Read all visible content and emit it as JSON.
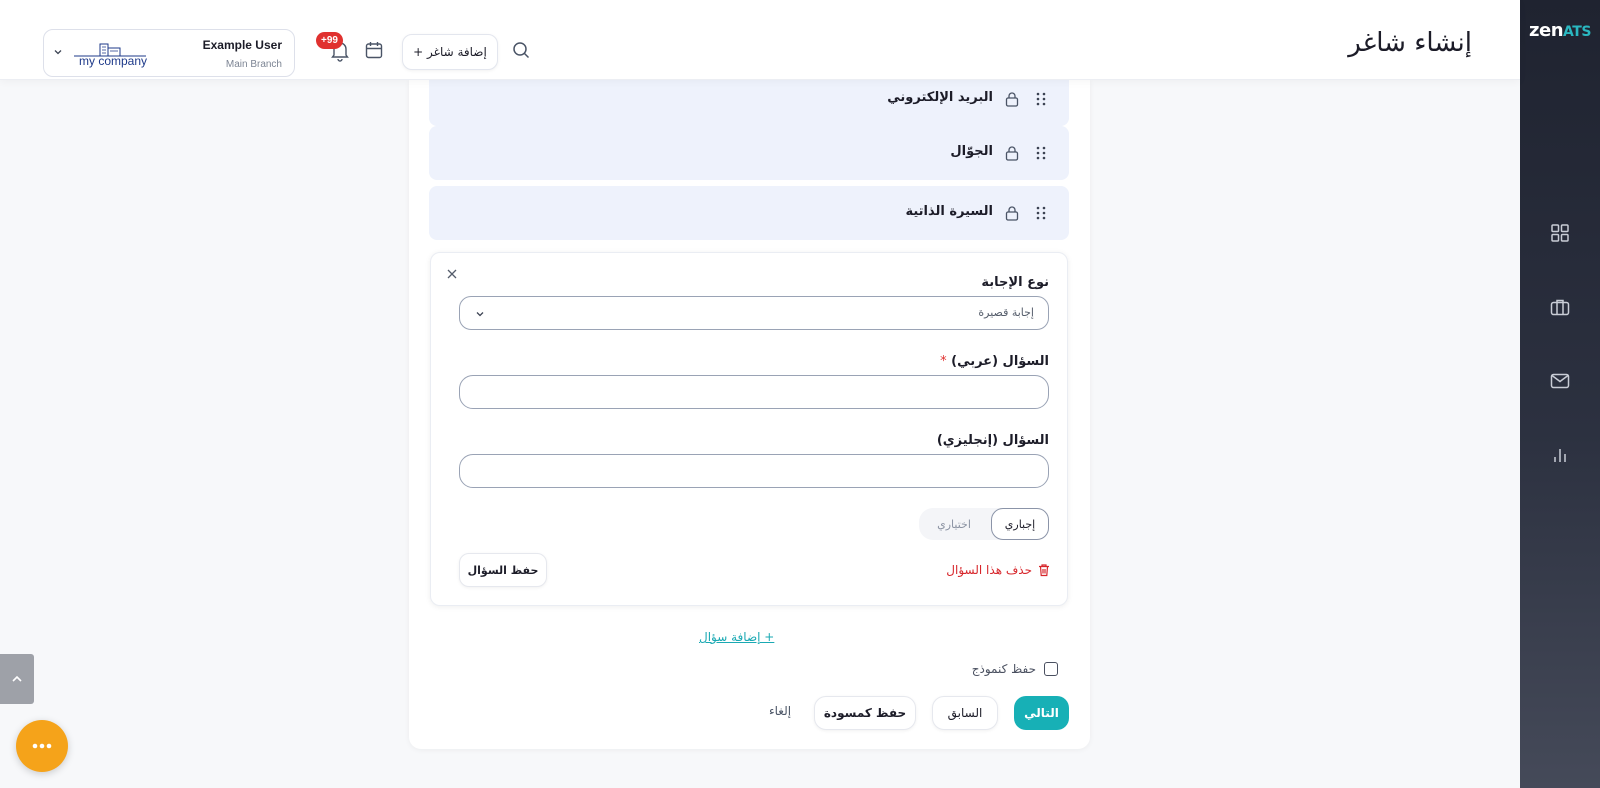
{
  "app": {
    "logo_main": "zen",
    "logo_accent": "ATS",
    "page_title": "إنشاء شاغر"
  },
  "header": {
    "user_name": "Example User",
    "branch": "Main Branch",
    "company_name": "my company",
    "notifications_badge": "+99",
    "add_job_label": "+ إضافة شاغر"
  },
  "sidebar": {
    "items": [
      {
        "icon": "dashboard-grid-icon"
      },
      {
        "icon": "briefcase-icon"
      },
      {
        "icon": "mail-icon"
      },
      {
        "icon": "bar-chart-icon"
      }
    ]
  },
  "fields": [
    {
      "label": "البريد الإلكتروني"
    },
    {
      "label": "الجوّال"
    },
    {
      "label": "السيرة الذاتية"
    }
  ],
  "question": {
    "answer_type_label": "نوع الإجابة",
    "answer_type_value": "إجابة قصيرة",
    "question_ar_label": "السؤال (عربي)",
    "required_mark": "*",
    "question_ar_value": "",
    "question_en_label": "السؤال (إنجليزي)",
    "question_en_value": "",
    "toggle_required": "إجباري",
    "toggle_optional": "اختياري",
    "delete_label": "حذف هذا السؤال",
    "save_label": "حفظ السؤال"
  },
  "actions": {
    "add_question": "+ إضافة سؤال",
    "save_as_template": "حفظ كنموذج",
    "next": "التالي",
    "previous": "السابق",
    "save_draft": "حفظ كمسودة",
    "cancel": "إلغاء"
  },
  "colors": {
    "accent": "#17b0b6",
    "danger": "#d7262b",
    "badge": "#e0312f",
    "fab": "#f5a31a"
  }
}
